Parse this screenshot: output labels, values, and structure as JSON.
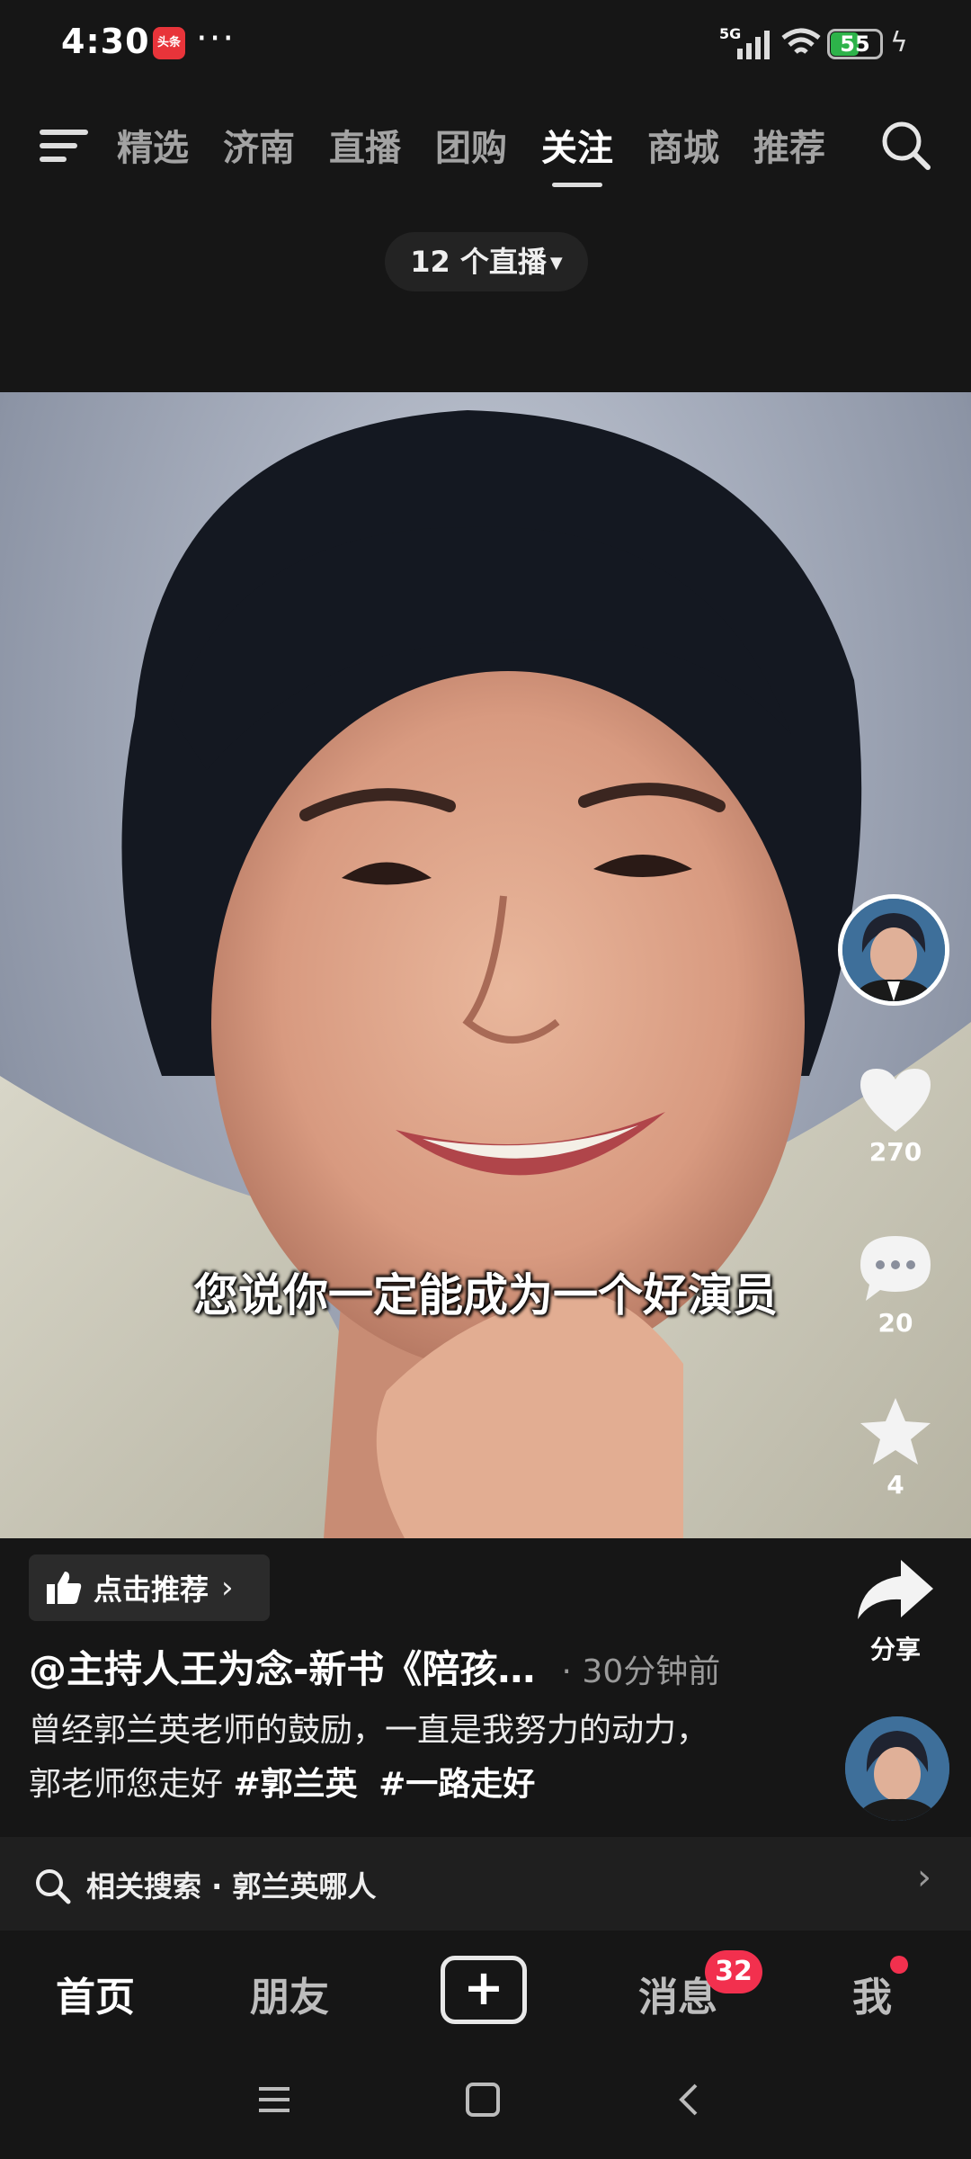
{
  "status_bar": {
    "time": "4:30",
    "app_badge": "头条",
    "more": "···",
    "network": "5G",
    "battery": "55",
    "battery_level": 0.55
  },
  "top_nav": {
    "tabs": [
      "精选",
      "济南",
      "直播",
      "团购",
      "关注",
      "商城",
      "推荐"
    ],
    "active_tab": "关注"
  },
  "live_pill": {
    "label": "12 个直播"
  },
  "video": {
    "subtitle": "您说你一定能成为一个好演员"
  },
  "actions": {
    "likes": "270",
    "comments": "20",
    "favorites": "4",
    "share_label": "分享"
  },
  "post": {
    "recommend_label": "点击推荐",
    "author": "@主持人王为念-新书《陪孩…",
    "time": "· 30分钟前",
    "description": "曾经郭兰英老师的鼓励，一直是我努力的动力，",
    "description2": "郭老师您走好 ",
    "tags": [
      "#郭兰英",
      "#一路走好"
    ]
  },
  "related_search": {
    "label": "相关搜索 · 郭兰英哪人"
  },
  "bottom_nav": {
    "home": "首页",
    "friends": "朋友",
    "messages": "消息",
    "messages_badge": "32",
    "me": "我"
  },
  "colors": {
    "background": "#161616",
    "badge_red": "#f2304e",
    "battery_green": "#2db34a"
  }
}
